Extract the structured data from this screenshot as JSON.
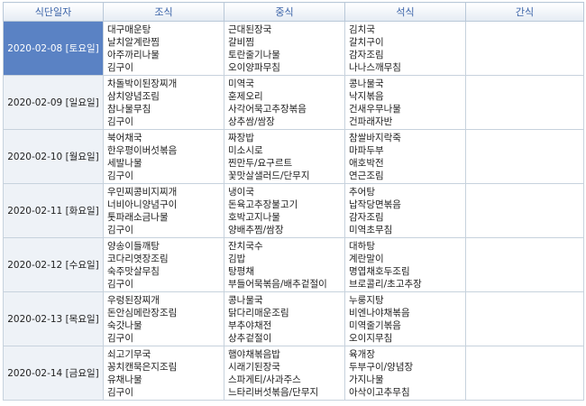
{
  "headers": [
    "식단일자",
    "조식",
    "중식",
    "석식",
    "간식"
  ],
  "days": [
    {
      "date": "2020-02-08 [토요일]",
      "selected": true,
      "breakfast": [
        "대구매운탕",
        "날치알계란찜",
        "아주까리나물",
        "김구이"
      ],
      "lunch": [
        "근대된장국",
        "갈비찜",
        "토란줄기나물",
        "오이양파무침"
      ],
      "dinner": [
        "김치국",
        "갈치구이",
        "감자조림",
        "나나스깨무침"
      ],
      "snack": []
    },
    {
      "date": "2020-02-09 [일요일]",
      "selected": false,
      "breakfast": [
        "차돌박이된장찌개",
        "삼치양념조림",
        "참나물무침",
        "김구이"
      ],
      "lunch": [
        "미역국",
        "훈제오리",
        "사각어묵고추장볶음",
        "상추쌈/쌈장"
      ],
      "dinner": [
        "콩나물국",
        "낙지볶음",
        "건새우무나물",
        "건파래자반"
      ],
      "snack": []
    },
    {
      "date": "2020-02-10 [월요일]",
      "selected": false,
      "breakfast": [
        "북어채국",
        "한우평이버섯볶음",
        "세발나물",
        "김구이"
      ],
      "lunch": [
        "짜장밥",
        "미소시로",
        "찐만두/요구르트",
        "꽃맛살샐러드/단무지"
      ],
      "dinner": [
        "참쌀바지락죽",
        "마파두부",
        "애호박전",
        "연근조림"
      ],
      "snack": []
    },
    {
      "date": "2020-02-11 [화요일]",
      "selected": false,
      "breakfast": [
        "우민찌콩비지찌개",
        "너비아니양념구이",
        "톳파래소금나물",
        "김구이"
      ],
      "lunch": [
        "냉이국",
        "돈육고추장불고기",
        "호박고지나물",
        "양배추찜/쌈장"
      ],
      "dinner": [
        "추어탕",
        "납작당면볶음",
        "감자조림",
        "미역초무침"
      ],
      "snack": []
    },
    {
      "date": "2020-02-12 [수요일]",
      "selected": false,
      "breakfast": [
        "양송이들깨탕",
        "코다리엿장조림",
        "숙주맛살무침",
        "김구이"
      ],
      "lunch": [
        "잔치국수",
        "김밥",
        "탕평채",
        "부들어묵볶음/배추겉절이"
      ],
      "dinner": [
        "대하탕",
        "계란말이",
        "명엽채호두조림",
        "브로콜리/초고추장"
      ],
      "snack": []
    },
    {
      "date": "2020-02-13 [목요일]",
      "selected": false,
      "breakfast": [
        "우렁된장찌개",
        "돈안심메란장조림",
        "숙갓나물",
        "김구이"
      ],
      "lunch": [
        "콩나물국",
        "닭다리매운조림",
        "부추야채전",
        "상추겉절이"
      ],
      "dinner": [
        "누룽지탕",
        "비엔나야채볶음",
        "미역줄기볶음",
        "오이지무침"
      ],
      "snack": []
    },
    {
      "date": "2020-02-14 [금요일]",
      "selected": false,
      "breakfast": [
        "쇠고기무국",
        "꽁치캔묵은지조림",
        "유채나물",
        "김구이"
      ],
      "lunch": [
        "햄야채볶음밥",
        "시래기된장국",
        "스파게티/사과주스",
        "느타리버섯볶음/단무지"
      ],
      "dinner": [
        "육개장",
        "두부구이/양념장",
        "가지나물",
        "아삭이고추무침"
      ],
      "snack": []
    }
  ],
  "colors": {
    "header_text": "#3a63a8",
    "selected_bg": "#5a82c4",
    "border": "#c7d2dd"
  }
}
